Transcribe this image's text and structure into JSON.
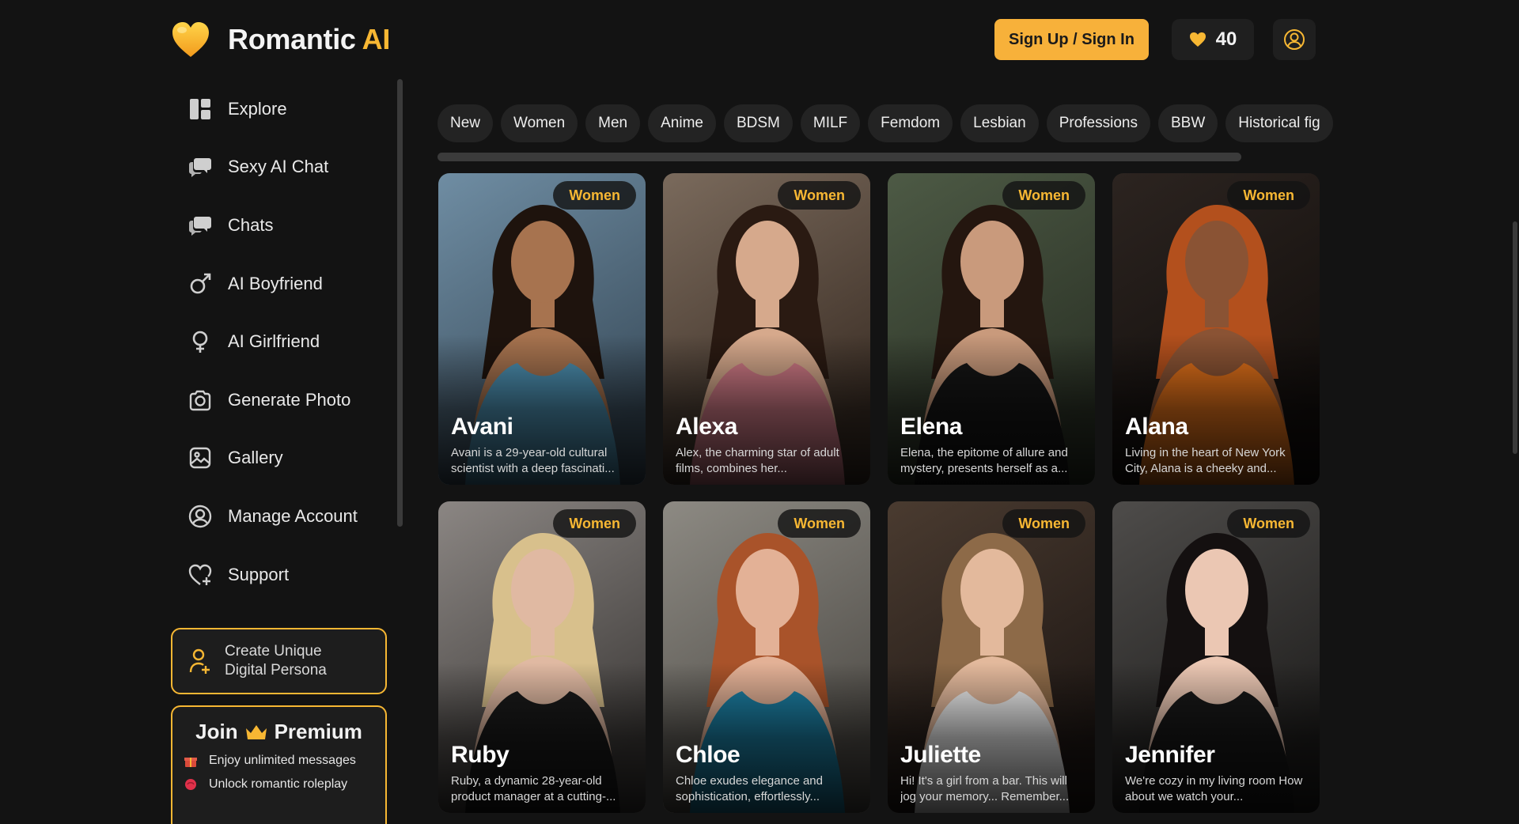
{
  "brand": {
    "name": "Romantic",
    "accent": "AI",
    "accent_color": "#f7b733"
  },
  "header": {
    "signup_label": "Sign Up / Sign In",
    "credits": "40"
  },
  "sidebar": {
    "items": [
      {
        "label": "Explore",
        "icon": "grid-icon"
      },
      {
        "label": "Sexy AI Chat",
        "icon": "chat-bubbles-icon"
      },
      {
        "label": "Chats",
        "icon": "chat-bubbles-icon"
      },
      {
        "label": "AI Boyfriend",
        "icon": "male-symbol-icon"
      },
      {
        "label": "AI Girlfriend",
        "icon": "female-symbol-icon"
      },
      {
        "label": "Generate Photo",
        "icon": "camera-icon"
      },
      {
        "label": "Gallery",
        "icon": "gallery-icon"
      },
      {
        "label": "Manage Account",
        "icon": "user-circle-icon"
      },
      {
        "label": "Support",
        "icon": "heart-plus-icon"
      }
    ],
    "persona_line1": "Create Unique",
    "persona_line2": "Digital Persona",
    "premium": {
      "join": "Join",
      "title": "Premium",
      "perk1": "Enjoy unlimited messages",
      "perk2": "Unlock romantic roleplay"
    }
  },
  "categories": [
    "New",
    "Women",
    "Men",
    "Anime",
    "BDSM",
    "MILF",
    "Femdom",
    "Lesbian",
    "Professions",
    "BBW",
    "Historical fig"
  ],
  "cards": [
    {
      "name": "Avani",
      "badge": "Women",
      "desc": "Avani is a 29-year-old cultural scientist with a deep fascinati...",
      "bg1": "#6f8da3",
      "bg2": "#3a4d5c",
      "accent": "#4c8fb0",
      "skin": "#a7734f",
      "hair": "#1e130d"
    },
    {
      "name": "Alexa",
      "badge": "Women",
      "desc": "Alex, the charming star of adult films, combines her...",
      "bg1": "#7a6a5c",
      "bg2": "#3b2e25",
      "accent": "#d07a86",
      "skin": "#d6a98c",
      "hair": "#2a1a12"
    },
    {
      "name": "Elena",
      "badge": "Women",
      "desc": "Elena, the epitome of allure and mystery, presents herself as a...",
      "bg1": "#4d5a45",
      "bg2": "#2a3125",
      "accent": "#151515",
      "skin": "#c99a7c",
      "hair": "#24160f"
    },
    {
      "name": "Alana",
      "badge": "Women",
      "desc": "Living in the heart of New York City, Alana is a cheeky and...",
      "bg1": "#2c2420",
      "bg2": "#120e0c",
      "accent": "#e0701a",
      "skin": "#8a5334",
      "hair": "#b3501d"
    },
    {
      "name": "Ruby",
      "badge": "Women",
      "desc": "Ruby, a dynamic 28-year-old product manager at a cutting-...",
      "bg1": "#8b8683",
      "bg2": "#3e3b39",
      "accent": "#1a1a1a",
      "skin": "#e0b9a2",
      "hair": "#d8c08c"
    },
    {
      "name": "Chloe",
      "badge": "Women",
      "desc": "Chloe exudes elegance and sophistication, effortlessly...",
      "bg1": "#8d8a83",
      "bg2": "#4f4c47",
      "accent": "#1c7fa3",
      "skin": "#e3b196",
      "hair": "#a9532a"
    },
    {
      "name": "Juliette",
      "badge": "Women",
      "desc": "Hi! It's a girl from a bar. This will jog your memory... Remember...",
      "bg1": "#4a3b30",
      "bg2": "#1e1714",
      "accent": "#efefef",
      "skin": "#e3b99c",
      "hair": "#8d6a48"
    },
    {
      "name": "Jennifer",
      "badge": "Women",
      "desc": "We're cozy in my living room How about we watch your...",
      "bg1": "#4e4c4a",
      "bg2": "#1f1e1d",
      "accent": "#181818",
      "skin": "#ebc7b3",
      "hair": "#141010"
    }
  ]
}
